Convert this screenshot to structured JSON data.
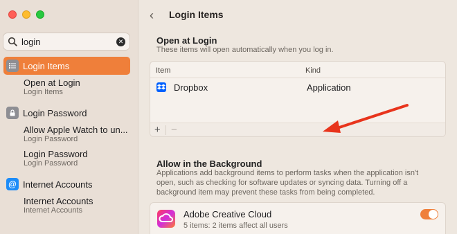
{
  "sidebar": {
    "search": {
      "value": "login",
      "placeholder": "Search"
    },
    "items": [
      {
        "label": "Login Items",
        "selected": true,
        "icon": "list-icon"
      },
      {
        "title": "Open at Login",
        "subtitle": "Login Items"
      },
      {
        "label": "Login Password",
        "icon": "lock-icon"
      },
      {
        "title": "Allow Apple Watch to un...",
        "subtitle": "Login Password"
      },
      {
        "title": "Login Password",
        "subtitle": "Login Password"
      },
      {
        "label": "Internet Accounts",
        "icon": "at-icon"
      },
      {
        "title": "Internet Accounts",
        "subtitle": "Internet Accounts"
      }
    ]
  },
  "main": {
    "title": "Login Items",
    "open_at_login": {
      "title": "Open at Login",
      "description": "These items will open automatically when you log in.",
      "columns": {
        "item": "Item",
        "kind": "Kind"
      },
      "rows": [
        {
          "name": "Dropbox",
          "kind": "Application"
        }
      ],
      "add_label": "+",
      "remove_label": "−"
    },
    "background": {
      "title": "Allow in the Background",
      "description_lines": [
        "Applications add background items to perform tasks when the application isn't",
        "open, such as checking for software updates or syncing data. Turning off a",
        "background item may prevent these tasks from being completed."
      ],
      "apps": [
        {
          "name": "Adobe Creative Cloud",
          "detail": "5 items: 2 items affect all users",
          "enabled": true
        }
      ]
    }
  },
  "colors": {
    "accent": "#ef7f3a",
    "annotation_arrow": "#e8341c"
  }
}
